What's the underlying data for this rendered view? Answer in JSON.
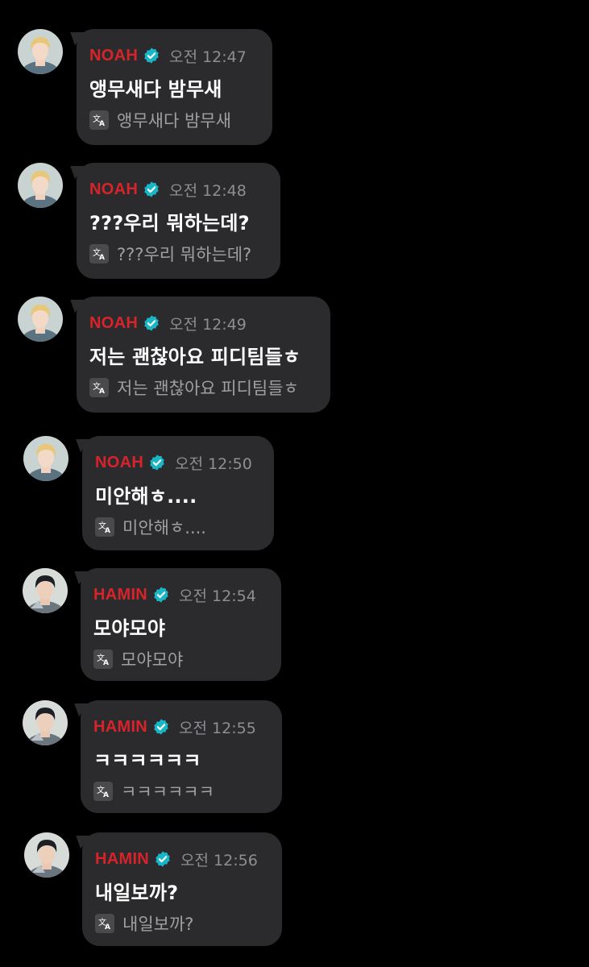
{
  "colors": {
    "sender_name": "#d8232a",
    "verified_badge": "#19b6c8",
    "bubble": "#2b2b2d",
    "timestamp": "#8e8e93"
  },
  "icons": {
    "badge": "verified-badge-icon",
    "translate": "translate-icon"
  },
  "messages": [
    {
      "sender": "NOAH",
      "time": "오전 12:47",
      "text": "앵무새다 밤무새",
      "translation": "앵무새다 밤무새"
    },
    {
      "sender": "NOAH",
      "time": "오전 12:48",
      "text": "???우리 뭐하는데?",
      "translation": "???우리 뭐하는데?"
    },
    {
      "sender": "NOAH",
      "time": "오전 12:49",
      "text": "저는 괜찮아요 피디팀들ㅎ",
      "translation": "저는 괜찮아요 피디팀들ㅎ"
    },
    {
      "sender": "NOAH",
      "time": "오전 12:50",
      "text": "미안해ㅎ....",
      "translation": "미안해ㅎ...."
    },
    {
      "sender": "HAMIN",
      "time": "오전 12:54",
      "text": "모야모야",
      "translation": "모야모야"
    },
    {
      "sender": "HAMIN",
      "time": "오전 12:55",
      "text": "ㅋㅋㅋㅋㅋㅋ",
      "translation": "ㅋㅋㅋㅋㅋㅋ"
    },
    {
      "sender": "HAMIN",
      "time": "오전 12:56",
      "text": "내일보까?",
      "translation": "내일보까?"
    }
  ]
}
